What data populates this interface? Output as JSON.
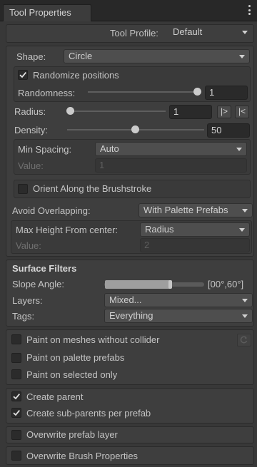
{
  "tab": {
    "title": "Tool Properties"
  },
  "tool_profile": {
    "label": "Tool Profile:",
    "value": "Default"
  },
  "shape": {
    "label": "Shape:",
    "value": "Circle"
  },
  "randomize": {
    "label": "Randomize positions",
    "checked": true
  },
  "randomness": {
    "label": "Randomness:",
    "value": "1",
    "level": 1.0
  },
  "radius": {
    "label": "Radius:",
    "value": "1",
    "level": 0.0,
    "btn_right": "|>",
    "btn_left": "|<"
  },
  "density": {
    "label": "Density:",
    "value": "50",
    "level": 0.5
  },
  "min_spacing": {
    "label": "Min Spacing:",
    "value": "Auto",
    "value_label": "Value:",
    "value_value": "1"
  },
  "orient": {
    "label": "Orient Along the Brushstroke",
    "checked": false
  },
  "avoid_overlapping": {
    "label": "Avoid Overlapping:",
    "value": "With Palette Prefabs"
  },
  "max_height": {
    "label": "Max Height From center:",
    "value": "Radius",
    "value_label": "Value:",
    "value_value": "2"
  },
  "surface_filters": {
    "title": "Surface Filters",
    "slope_label": "Slope Angle:",
    "slope_value": "[00°,60°]",
    "slope_range": [
      0,
      60
    ],
    "layers_label": "Layers:",
    "layers_value": "Mixed...",
    "tags_label": "Tags:",
    "tags_value": "Everything"
  },
  "paint_options": [
    {
      "label": "Paint on meshes without collider",
      "checked": false
    },
    {
      "label": "Paint on palette prefabs",
      "checked": false
    },
    {
      "label": "Paint on selected only",
      "checked": false
    }
  ],
  "parent_options": [
    {
      "label": "Create parent",
      "checked": true
    },
    {
      "label": "Create sub-parents per prefab",
      "checked": true
    }
  ],
  "overwrite_layer": {
    "label": "Overwrite prefab layer",
    "checked": false
  },
  "overwrite_brush": {
    "label": "Overwrite Brush Properties",
    "checked": false
  },
  "icons": {
    "menu": "kebab-menu-icon",
    "check": "checkmark-icon",
    "dropdown": "chevron-down-icon",
    "refresh": "refresh-icon"
  },
  "colors": {
    "background": "#383838",
    "panel": "#3e3e3e",
    "field": "#2a2a2a",
    "text": "#c4c4c4"
  }
}
